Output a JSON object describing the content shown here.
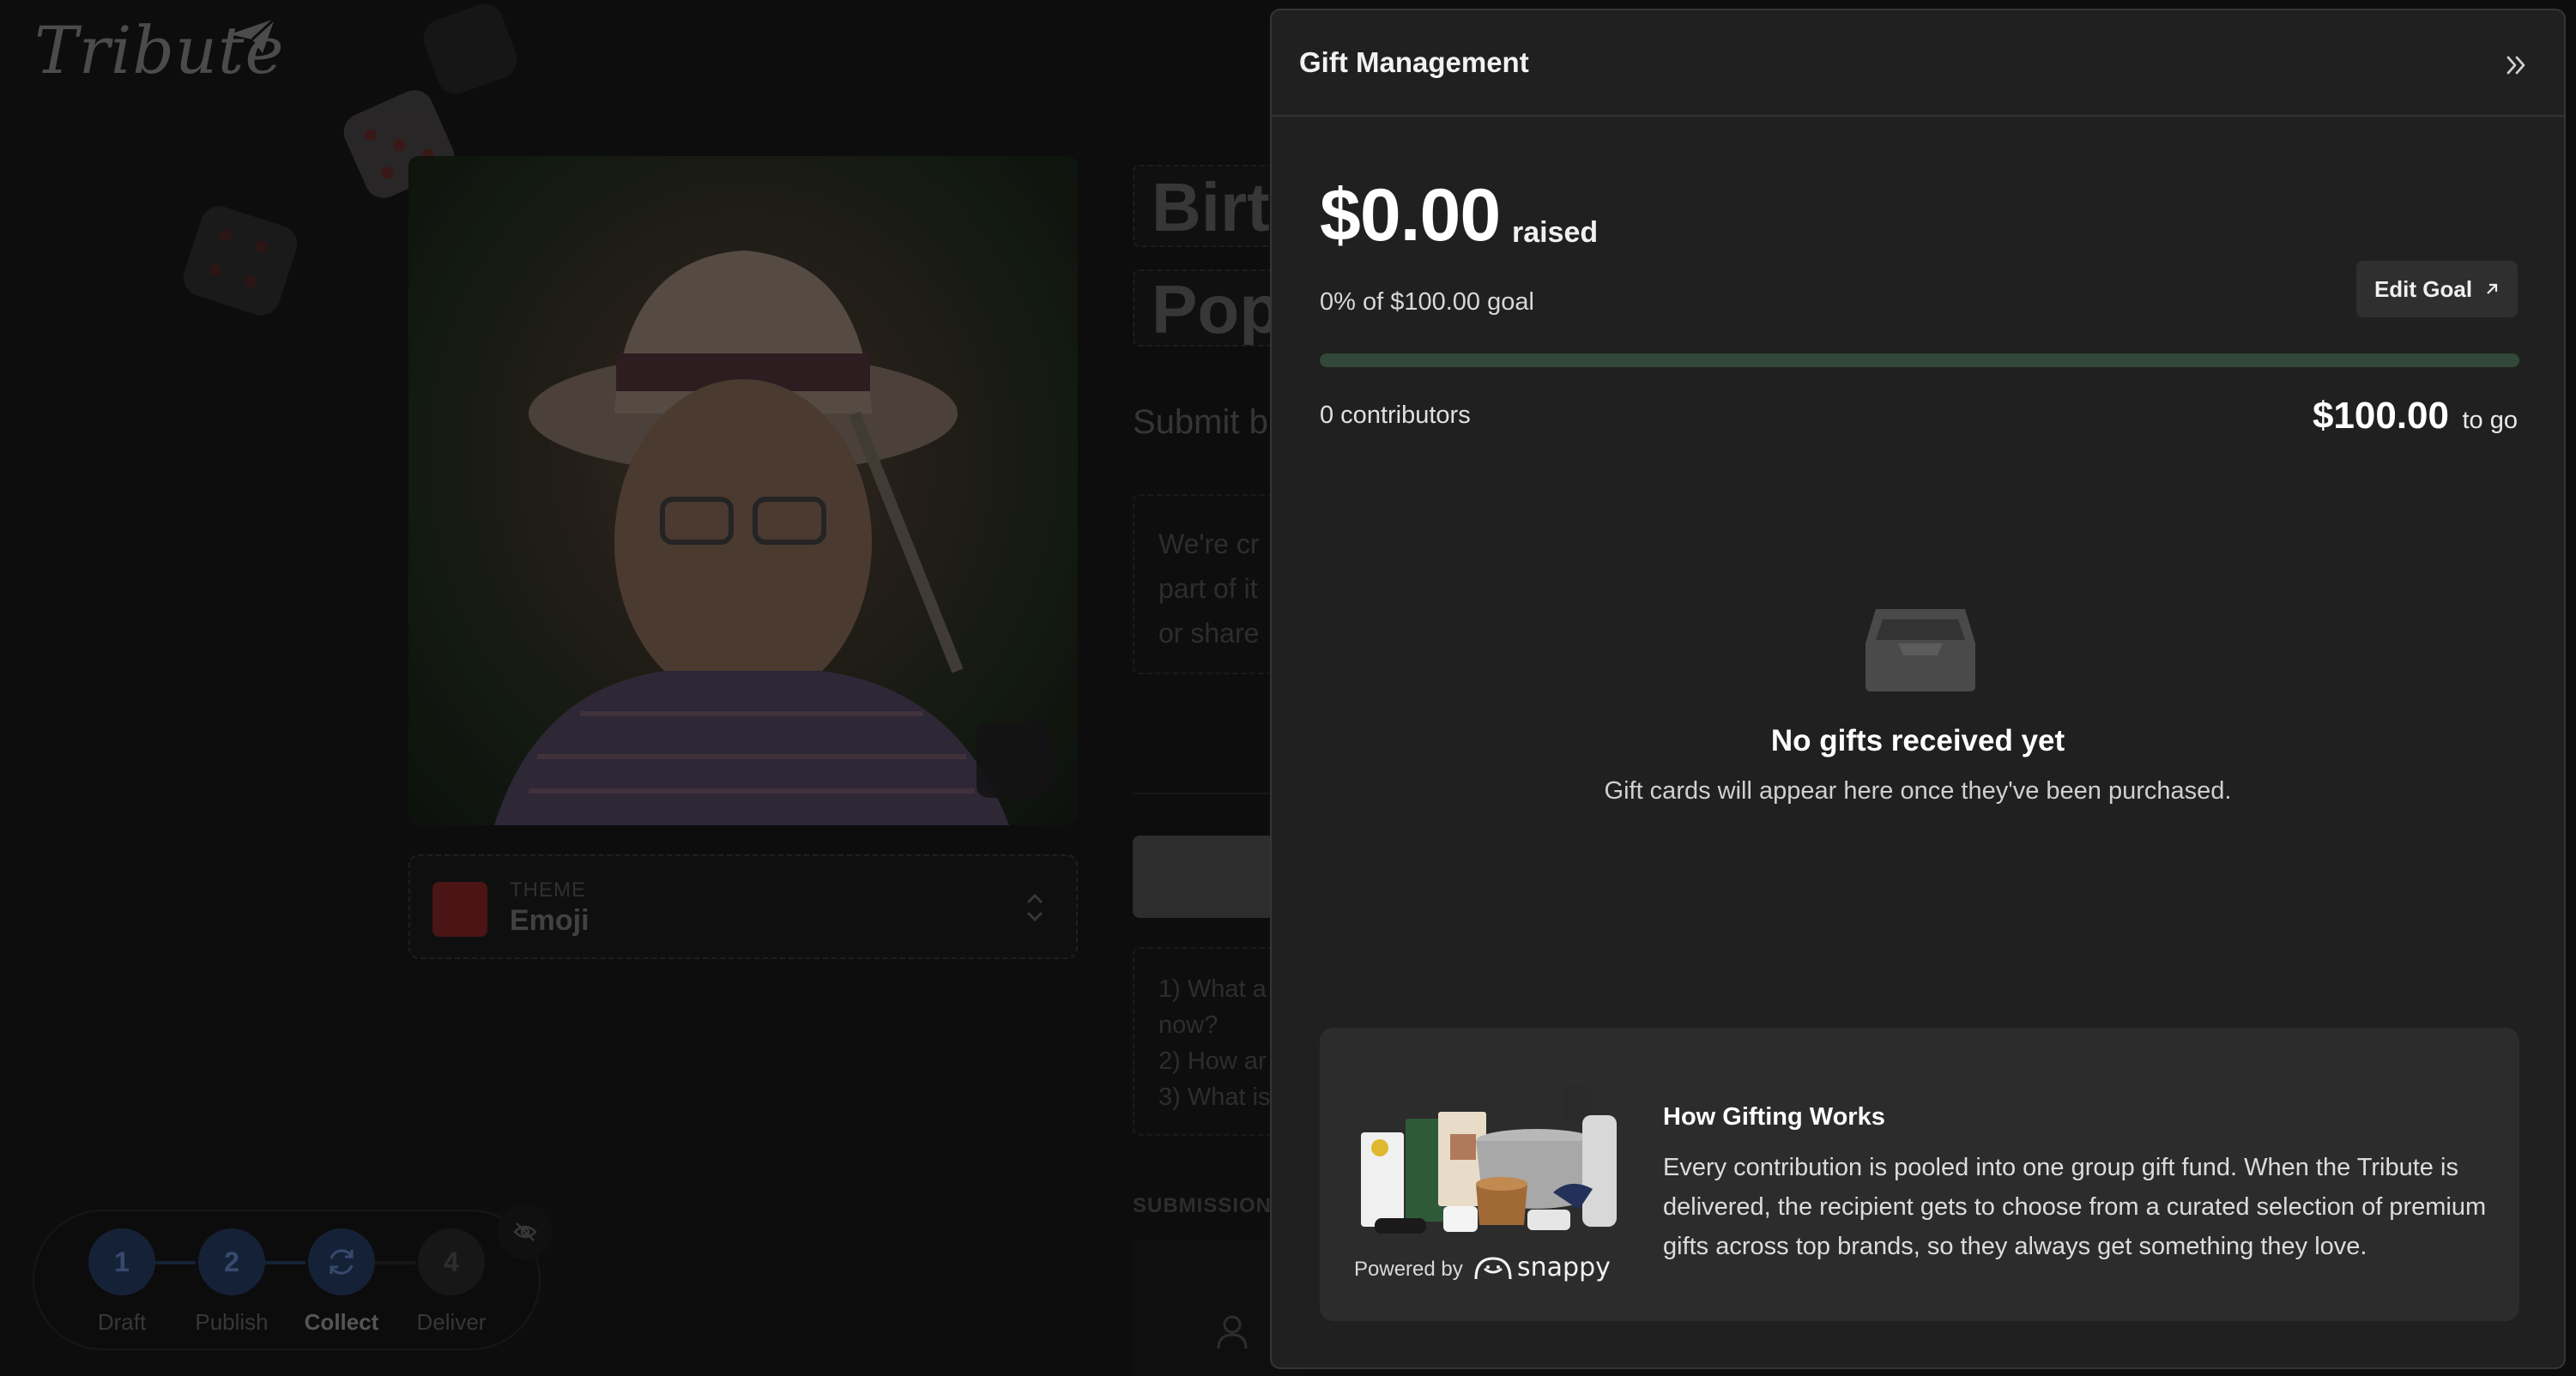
{
  "app": {
    "logo_text": "Tribute"
  },
  "tribute_page": {
    "title_line1": "Birt",
    "title_line2": "Pops",
    "subtitle": "Submit b",
    "description": [
      "We're cr",
      "part of it",
      "or share"
    ],
    "theme": {
      "caption": "THEME",
      "value": "Emoji"
    },
    "prompts": [
      "1) What a",
      "now?",
      "2) How ar",
      "3) What is"
    ],
    "submissions_label": "SUBMISSIONS"
  },
  "stepper": {
    "steps": [
      {
        "number": "1",
        "label": "Draft"
      },
      {
        "number": "2",
        "label": "Publish"
      },
      {
        "number": "",
        "label": "Collect"
      },
      {
        "number": "4",
        "label": "Deliver"
      }
    ],
    "current_step": "Collect"
  },
  "gift_panel": {
    "title": "Gift Management",
    "raised_amount": "$0.00",
    "raised_label": "raised",
    "goal_text": "0% of $100.00 goal",
    "progress_percent": 0,
    "edit_goal_label": "Edit Goal",
    "contributors_text": "0 contributors",
    "to_go_amount": "$100.00",
    "to_go_label": "to go",
    "empty_title": "No gifts received yet",
    "empty_subtitle": "Gift cards will appear here once they've been purchased.",
    "how_it_works": {
      "title": "How Gifting Works",
      "body": "Every contribution is pooled into one group gift fund. When the Tribute is delivered, the recipient gets to choose from a curated selection of premium gifts across top brands, so they always get something they love.",
      "powered_by": "Powered by",
      "partner_name": "snappy"
    }
  },
  "colors": {
    "panel_bg": "#202020",
    "progress_track": "#33473a",
    "step_active": "#22365a"
  }
}
